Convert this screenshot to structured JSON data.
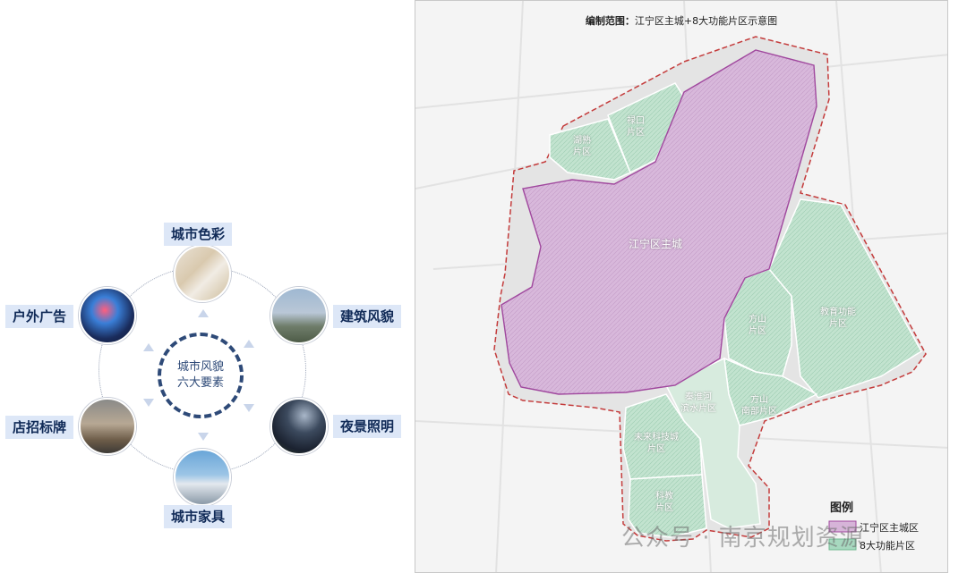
{
  "diagram": {
    "center": {
      "line1": "城市风貌",
      "line2": "六大要素"
    },
    "elements": [
      {
        "label": "城市色彩"
      },
      {
        "label": "建筑风貌"
      },
      {
        "label": "夜景照明"
      },
      {
        "label": "城市家具"
      },
      {
        "label": "店招标牌"
      },
      {
        "label": "户外广告"
      }
    ]
  },
  "map": {
    "title_prefix": "编制范围：",
    "title_rest": "江宁区主城+8大功能片区示意图",
    "main_zone": "江宁区主城",
    "zones": [
      {
        "line1": "湖熟",
        "line2": "片区"
      },
      {
        "line1": "禄口",
        "line2": "片区"
      },
      {
        "line1": "方山",
        "line2": "片区"
      },
      {
        "line1": "教育功能",
        "line2": "片区"
      },
      {
        "line1": "秦淮河",
        "line2": "滨水片区"
      },
      {
        "line1": "方山",
        "line2": "南部片区"
      },
      {
        "line1": "未来科技城",
        "line2": "片区"
      },
      {
        "line1": "科教",
        "line2": "片区"
      }
    ],
    "legend": {
      "title": "图例",
      "items": [
        {
          "label": "江宁区主城区",
          "color": "#d6b4d8"
        },
        {
          "label": "8大功能片区",
          "color": "#a7d8bf"
        }
      ]
    },
    "colors": {
      "main": "#d7b5da",
      "function": "#bfe2cd",
      "boundary": "#c43c3c"
    }
  },
  "watermark": "公众号 · 南京规划资源"
}
